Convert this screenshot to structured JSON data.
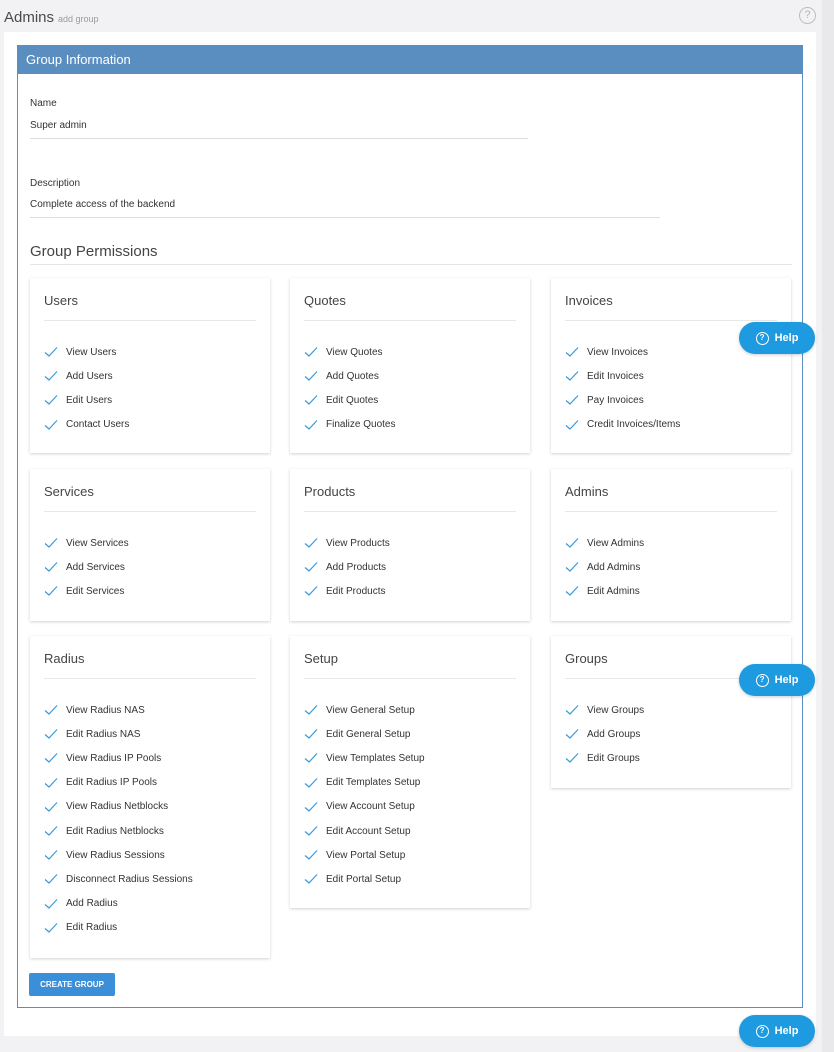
{
  "header": {
    "title": "Admins",
    "subtitle": "add group"
  },
  "panel": {
    "title": "Group Information"
  },
  "fields": {
    "name_label": "Name",
    "name_value": "Super admin",
    "description_label": "Description",
    "description_value": "Complete access of the backend"
  },
  "permissions_title": "Group Permissions",
  "groups": [
    {
      "title": "Users",
      "items": [
        "View Users",
        "Add Users",
        "Edit Users",
        "Contact Users"
      ]
    },
    {
      "title": "Quotes",
      "items": [
        "View Quotes",
        "Add Quotes",
        "Edit Quotes",
        "Finalize Quotes"
      ]
    },
    {
      "title": "Invoices",
      "items": [
        "View Invoices",
        "Edit Invoices",
        "Pay Invoices",
        "Credit Invoices/Items"
      ]
    },
    {
      "title": "Services",
      "items": [
        "View Services",
        "Add Services",
        "Edit Services"
      ]
    },
    {
      "title": "Products",
      "items": [
        "View Products",
        "Add Products",
        "Edit Products"
      ]
    },
    {
      "title": "Admins",
      "items": [
        "View Admins",
        "Add Admins",
        "Edit Admins"
      ]
    },
    {
      "title": "Radius",
      "items": [
        "View Radius NAS",
        "Edit Radius NAS",
        "View Radius IP Pools",
        "Edit Radius IP Pools",
        "View Radius Netblocks",
        "Edit Radius Netblocks",
        "View Radius Sessions",
        "Disconnect Radius Sessions",
        "Add Radius",
        "Edit Radius"
      ]
    },
    {
      "title": "Setup",
      "items": [
        "View General Setup",
        "Edit General Setup",
        "View Templates Setup",
        "Edit Templates Setup",
        "View Account Setup",
        "Edit Account Setup",
        "View Portal Setup",
        "Edit Portal Setup"
      ]
    },
    {
      "title": "Groups",
      "items": [
        "View Groups",
        "Add Groups",
        "Edit Groups"
      ]
    }
  ],
  "create_button": "CREATE GROUP",
  "help_label": "Help",
  "colors": {
    "accent": "#5b8ec0",
    "check": "#3a9ad9",
    "help": "#1e9ae0",
    "button": "#3a8fd8"
  },
  "icons": {
    "check": "check-icon",
    "help": "question-circle-icon"
  }
}
